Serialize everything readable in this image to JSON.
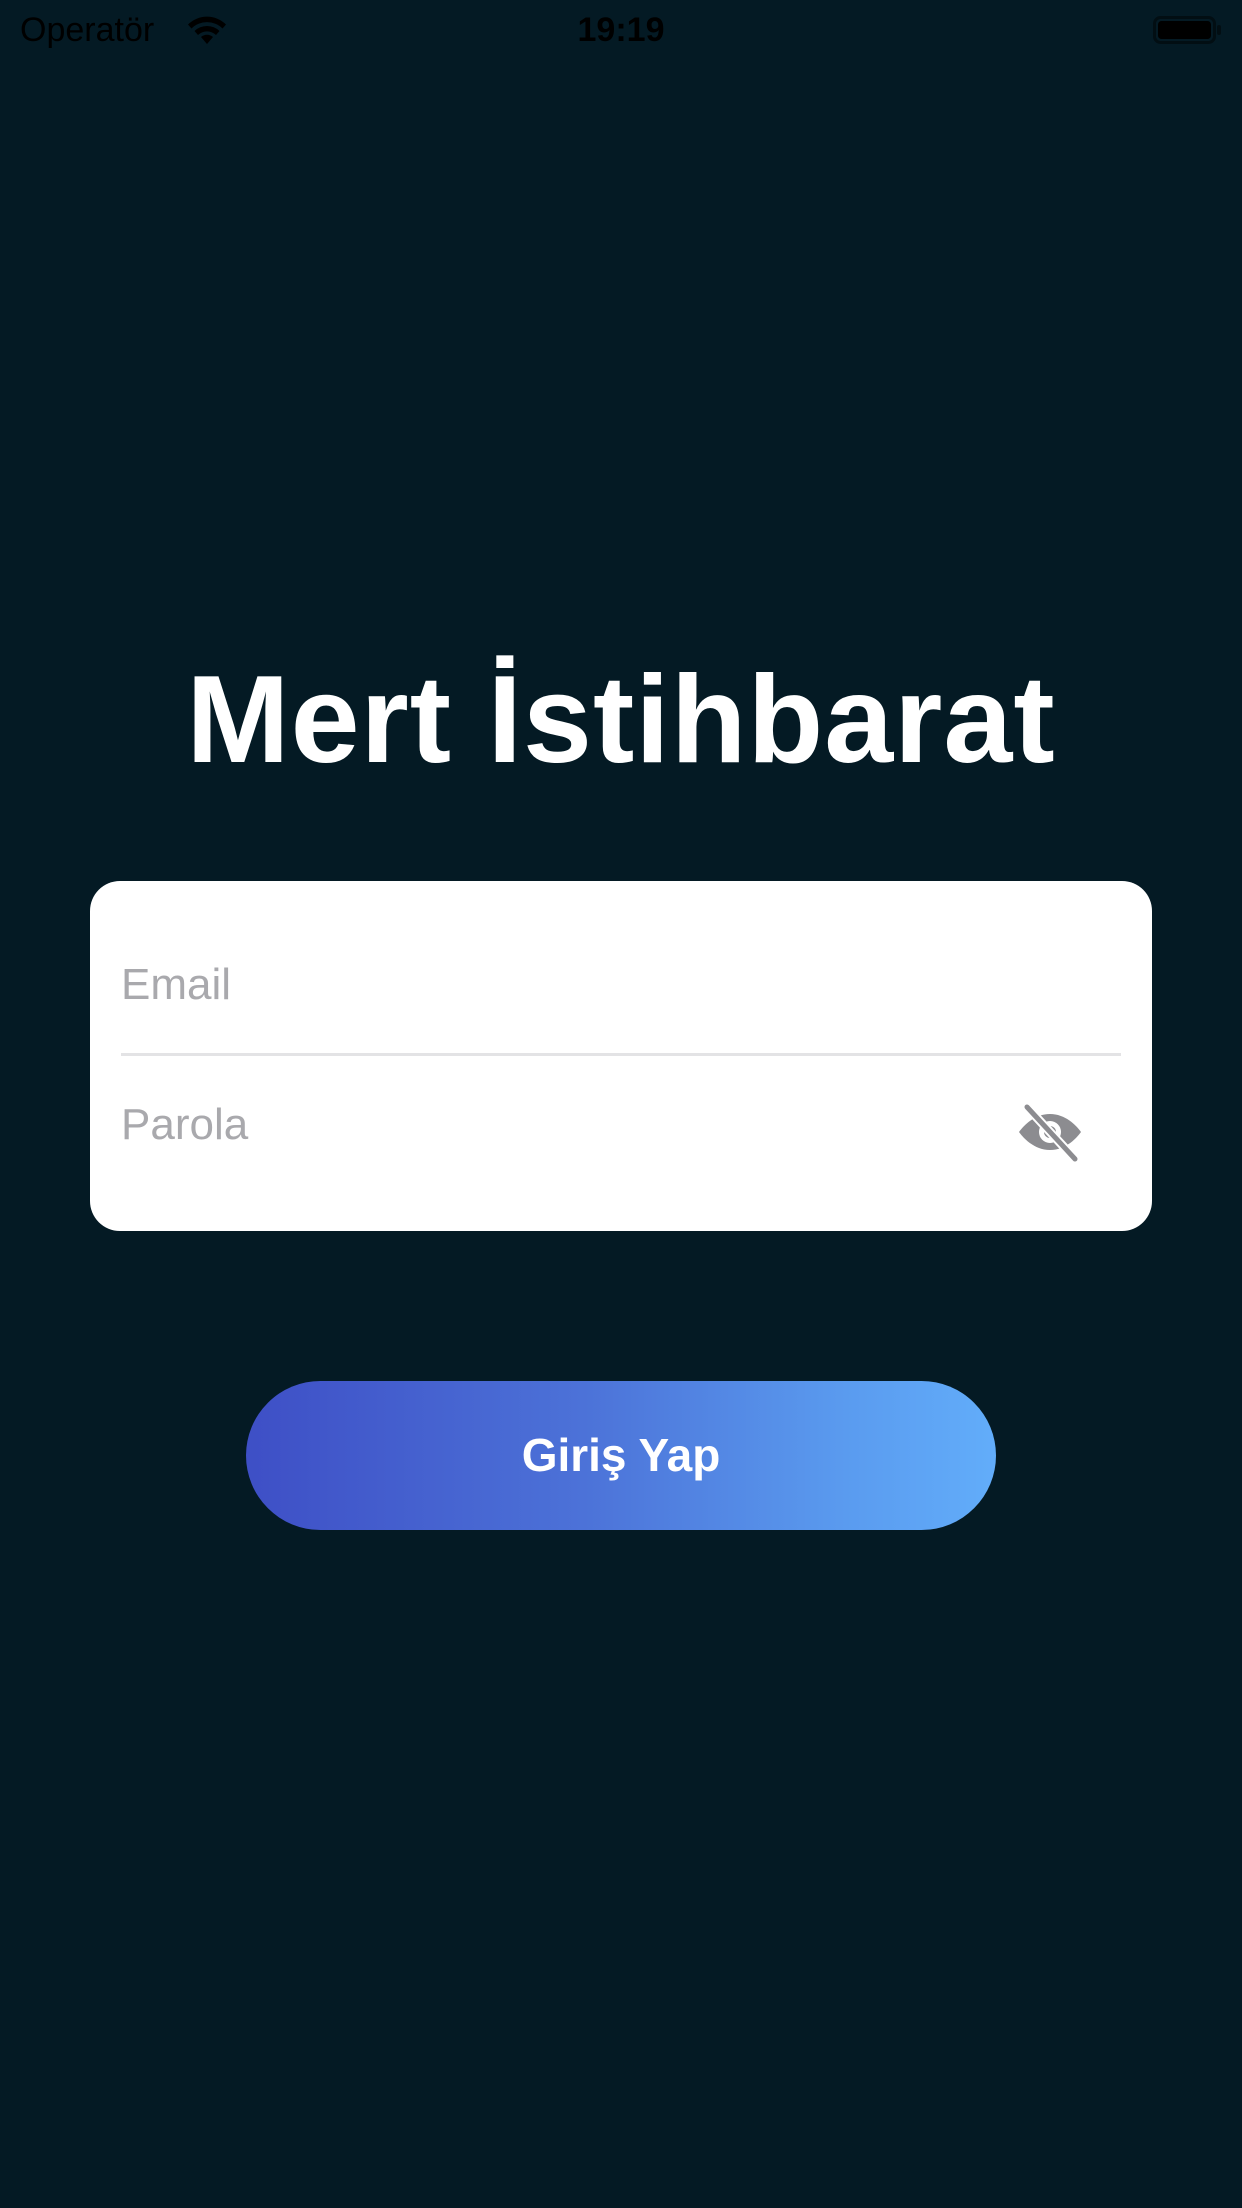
{
  "status_bar": {
    "carrier": "Operatör",
    "time": "19:19"
  },
  "app": {
    "title": "Mert İstihbarat"
  },
  "form": {
    "email_placeholder": "Email",
    "password_placeholder": "Parola",
    "password_visibility_icon": "eye-slash-icon"
  },
  "login_button": {
    "label": "Giriş Yap"
  },
  "colors": {
    "background": "#041a24",
    "card": "#ffffff",
    "placeholder": "#a9a9ad",
    "button_gradient_start": "#3e4fc6",
    "button_gradient_end": "#62adfa"
  }
}
